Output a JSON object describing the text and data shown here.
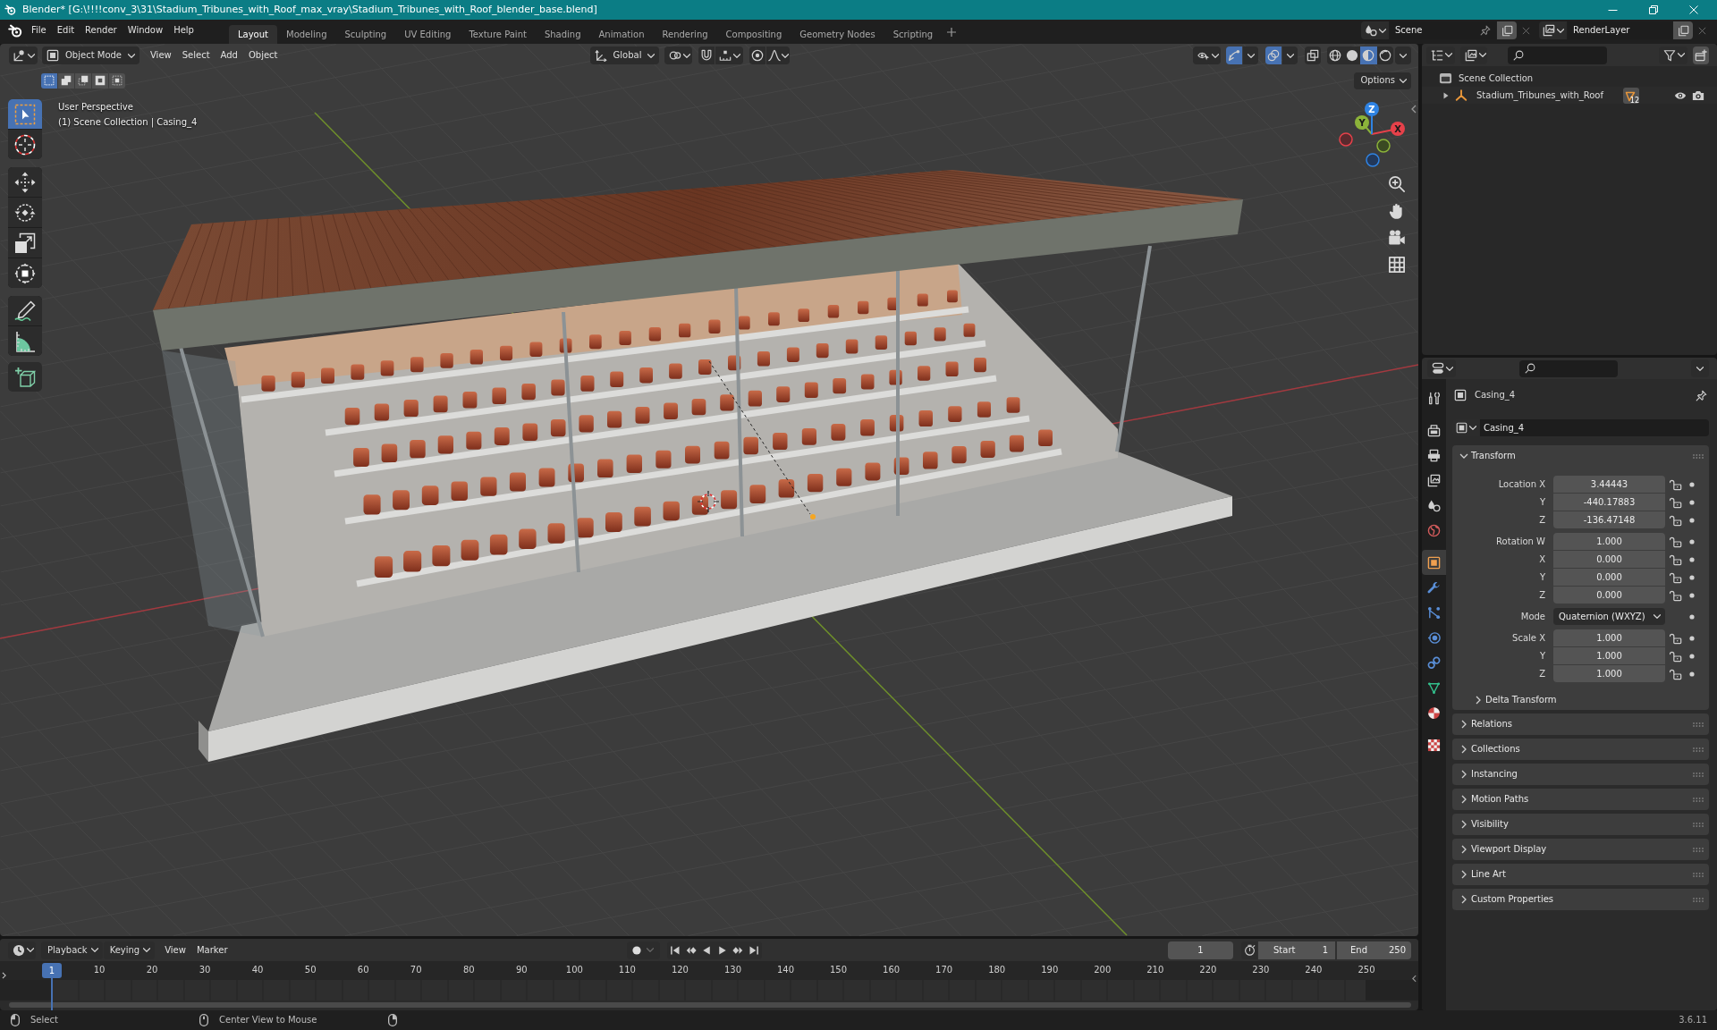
{
  "title_bar": {
    "title": "Blender* [G:\\!!!!conv_3\\31\\Stadium_Tribunes_with_Roof_max_vray\\Stadium_Tribunes_with_Roof_blender_base.blend]"
  },
  "top_bar": {
    "menus": [
      "File",
      "Edit",
      "Render",
      "Window",
      "Help"
    ],
    "workspaces": [
      {
        "label": "Layout",
        "selected": true
      },
      {
        "label": "Modeling",
        "selected": false
      },
      {
        "label": "Sculpting",
        "selected": false
      },
      {
        "label": "UV Editing",
        "selected": false
      },
      {
        "label": "Texture Paint",
        "selected": false
      },
      {
        "label": "Shading",
        "selected": false
      },
      {
        "label": "Animation",
        "selected": false
      },
      {
        "label": "Rendering",
        "selected": false
      },
      {
        "label": "Compositing",
        "selected": false
      },
      {
        "label": "Geometry Nodes",
        "selected": false
      },
      {
        "label": "Scripting",
        "selected": false
      }
    ],
    "scene": "Scene",
    "view_layer": "RenderLayer"
  },
  "viewport": {
    "mode": "Object Mode",
    "menus": [
      "View",
      "Select",
      "Add",
      "Object"
    ],
    "orientation": "Global",
    "snapping": {
      "on": false
    },
    "proportional_editing": {
      "on": false
    },
    "gizmos": {
      "on": true
    },
    "overlays": {
      "on": true
    },
    "xray": {
      "on": false
    },
    "shading": [
      {
        "kind": "wireframe",
        "selected": false
      },
      {
        "kind": "solid",
        "selected": false
      },
      {
        "kind": "material",
        "selected": true
      },
      {
        "kind": "rendered",
        "selected": false
      }
    ],
    "select_modes": [
      {
        "kind": "set",
        "selected": true
      },
      {
        "kind": "extend",
        "selected": false
      },
      {
        "kind": "subtract",
        "selected": false
      },
      {
        "kind": "invert",
        "selected": false
      },
      {
        "kind": "intersect",
        "selected": false
      }
    ],
    "options": "Options",
    "tool_groups": [
      {
        "tools": [
          {
            "kind": "select-box",
            "selected": true
          },
          {
            "kind": "cursor",
            "selected": false
          }
        ]
      },
      {
        "tools": [
          {
            "kind": "move",
            "selected": false
          },
          {
            "kind": "rotate",
            "selected": false
          },
          {
            "kind": "scale",
            "selected": false
          },
          {
            "kind": "transform",
            "selected": false
          }
        ]
      },
      {
        "tools": [
          {
            "kind": "annotate",
            "selected": false
          },
          {
            "kind": "measure",
            "selected": false
          }
        ]
      },
      {
        "tools": [
          {
            "kind": "add-cube",
            "selected": false
          }
        ]
      }
    ],
    "info": [
      "User Perspective",
      "(1) Scene Collection | Casing_4"
    ],
    "gizmo_axes": [
      {
        "kind": "x",
        "label": "X"
      },
      {
        "kind": "y",
        "label": "Y"
      },
      {
        "kind": "z",
        "label": "Z"
      }
    ]
  },
  "outliner": {
    "items": [
      {
        "label": "Scene Collection",
        "children": [
          {
            "label": "Stadium_Tribunes_with_Roof",
            "expanded": false,
            "badge": "12"
          }
        ]
      }
    ]
  },
  "properties": {
    "tab_groups": [
      {
        "tabs": [
          {
            "kind": "tool",
            "selected": false
          }
        ]
      },
      {
        "tabs": [
          {
            "kind": "render",
            "selected": false
          },
          {
            "kind": "output",
            "selected": false
          },
          {
            "kind": "view-layer",
            "selected": false
          },
          {
            "kind": "scene",
            "selected": false
          },
          {
            "kind": "world",
            "selected": false
          }
        ]
      },
      {
        "tabs": [
          {
            "kind": "object",
            "selected": true
          },
          {
            "kind": "modifiers",
            "selected": false
          },
          {
            "kind": "particles",
            "selected": false
          },
          {
            "kind": "physics",
            "selected": false
          },
          {
            "kind": "constraints",
            "selected": false
          },
          {
            "kind": "data",
            "selected": false
          },
          {
            "kind": "material",
            "selected": false
          }
        ]
      },
      {
        "tabs": [
          {
            "kind": "texture",
            "selected": false
          }
        ]
      }
    ],
    "context": "Casing_4",
    "object_name": "Casing_4",
    "panels": [
      {
        "title": "Transform",
        "expanded": true,
        "groups": [
          {
            "rows": [
              {
                "kind": "number",
                "label": "Location X",
                "value": "3.44443"
              },
              {
                "kind": "number",
                "label": "Y",
                "value": "-440.17883"
              },
              {
                "kind": "number",
                "label": "Z",
                "value": "-136.47148"
              }
            ]
          },
          {
            "rows": [
              {
                "kind": "number",
                "label": "Rotation W",
                "value": "1.000"
              },
              {
                "kind": "number",
                "label": "X",
                "value": "0.000"
              },
              {
                "kind": "number",
                "label": "Y",
                "value": "0.000"
              },
              {
                "kind": "number",
                "label": "Z",
                "value": "0.000"
              }
            ]
          },
          {
            "rows": [
              {
                "kind": "dropdown",
                "label": "Mode",
                "value": "Quaternion (WXYZ)"
              }
            ]
          },
          {
            "rows": [
              {
                "kind": "number",
                "label": "Scale X",
                "value": "1.000"
              },
              {
                "kind": "number",
                "label": "Y",
                "value": "1.000"
              },
              {
                "kind": "number",
                "label": "Z",
                "value": "1.000"
              }
            ]
          }
        ],
        "subpanels": [
          {
            "title": "Delta Transform",
            "expanded": false
          }
        ]
      },
      {
        "title": "Relations",
        "expanded": false
      },
      {
        "title": "Collections",
        "expanded": false
      },
      {
        "title": "Instancing",
        "expanded": false
      },
      {
        "title": "Motion Paths",
        "expanded": false
      },
      {
        "title": "Visibility",
        "expanded": false
      },
      {
        "title": "Viewport Display",
        "expanded": false
      },
      {
        "title": "Line Art",
        "expanded": false
      },
      {
        "title": "Custom Properties",
        "expanded": false
      }
    ]
  },
  "timeline": {
    "menus": [
      {
        "label": "Playback",
        "dropdown": true
      },
      {
        "label": "Keying",
        "dropdown": true
      },
      {
        "label": "View",
        "dropdown": false
      },
      {
        "label": "Marker",
        "dropdown": false
      }
    ],
    "auto_keying": {
      "on": false
    },
    "current_frame": "1",
    "start": {
      "label": "Start",
      "value": "1"
    },
    "end": {
      "label": "End",
      "value": "250"
    },
    "ruler": [
      {
        "label": "1",
        "selected": true
      },
      {
        "label": "10",
        "selected": false
      },
      {
        "label": "20",
        "selected": false
      },
      {
        "label": "30",
        "selected": false
      },
      {
        "label": "40",
        "selected": false
      },
      {
        "label": "50",
        "selected": false
      },
      {
        "label": "60",
        "selected": false
      },
      {
        "label": "70",
        "selected": false
      },
      {
        "label": "80",
        "selected": false
      },
      {
        "label": "90",
        "selected": false
      },
      {
        "label": "100",
        "selected": false
      },
      {
        "label": "110",
        "selected": false
      },
      {
        "label": "120",
        "selected": false
      },
      {
        "label": "130",
        "selected": false
      },
      {
        "label": "140",
        "selected": false
      },
      {
        "label": "150",
        "selected": false
      },
      {
        "label": "160",
        "selected": false
      },
      {
        "label": "170",
        "selected": false
      },
      {
        "label": "180",
        "selected": false
      },
      {
        "label": "190",
        "selected": false
      },
      {
        "label": "200",
        "selected": false
      },
      {
        "label": "210",
        "selected": false
      },
      {
        "label": "220",
        "selected": false
      },
      {
        "label": "230",
        "selected": false
      },
      {
        "label": "240",
        "selected": false
      },
      {
        "label": "250",
        "selected": false
      }
    ]
  },
  "status_bar": {
    "hints": [
      {
        "kind": "left",
        "label": "Select"
      },
      {
        "kind": "middle",
        "label": "Center View to Mouse"
      },
      {
        "kind": "right"
      }
    ],
    "version": "3.6.11"
  }
}
